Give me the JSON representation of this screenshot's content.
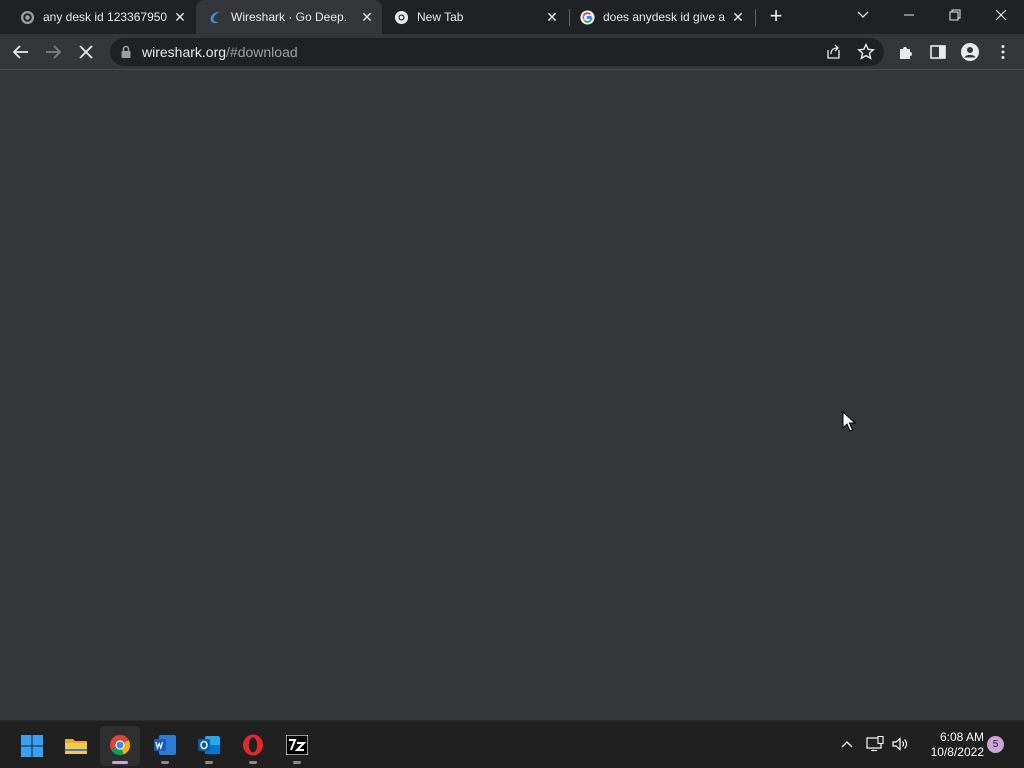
{
  "browser": {
    "tabs": [
      {
        "title": "any desk id 123367950",
        "icon": "anydesk-favicon"
      },
      {
        "title": "Wireshark · Go Deep.",
        "icon": "wireshark-favicon"
      },
      {
        "title": "New Tab",
        "icon": "chrome-favicon"
      },
      {
        "title": "does anydesk id give a",
        "icon": "google-favicon"
      }
    ],
    "omnibox": {
      "host": "wireshark.org",
      "path": "/#download"
    }
  },
  "taskbar": {
    "apps": [
      "start",
      "file-explorer",
      "chrome",
      "word",
      "outlook",
      "opera",
      "7zip"
    ],
    "time": "6:08 AM",
    "date": "10/8/2022",
    "notification_count": "5"
  },
  "colors": {
    "tab_bg": "#202124",
    "toolbar_bg": "#35363a",
    "taskbar_bg": "#202020",
    "accent": "#c9a6d8"
  }
}
